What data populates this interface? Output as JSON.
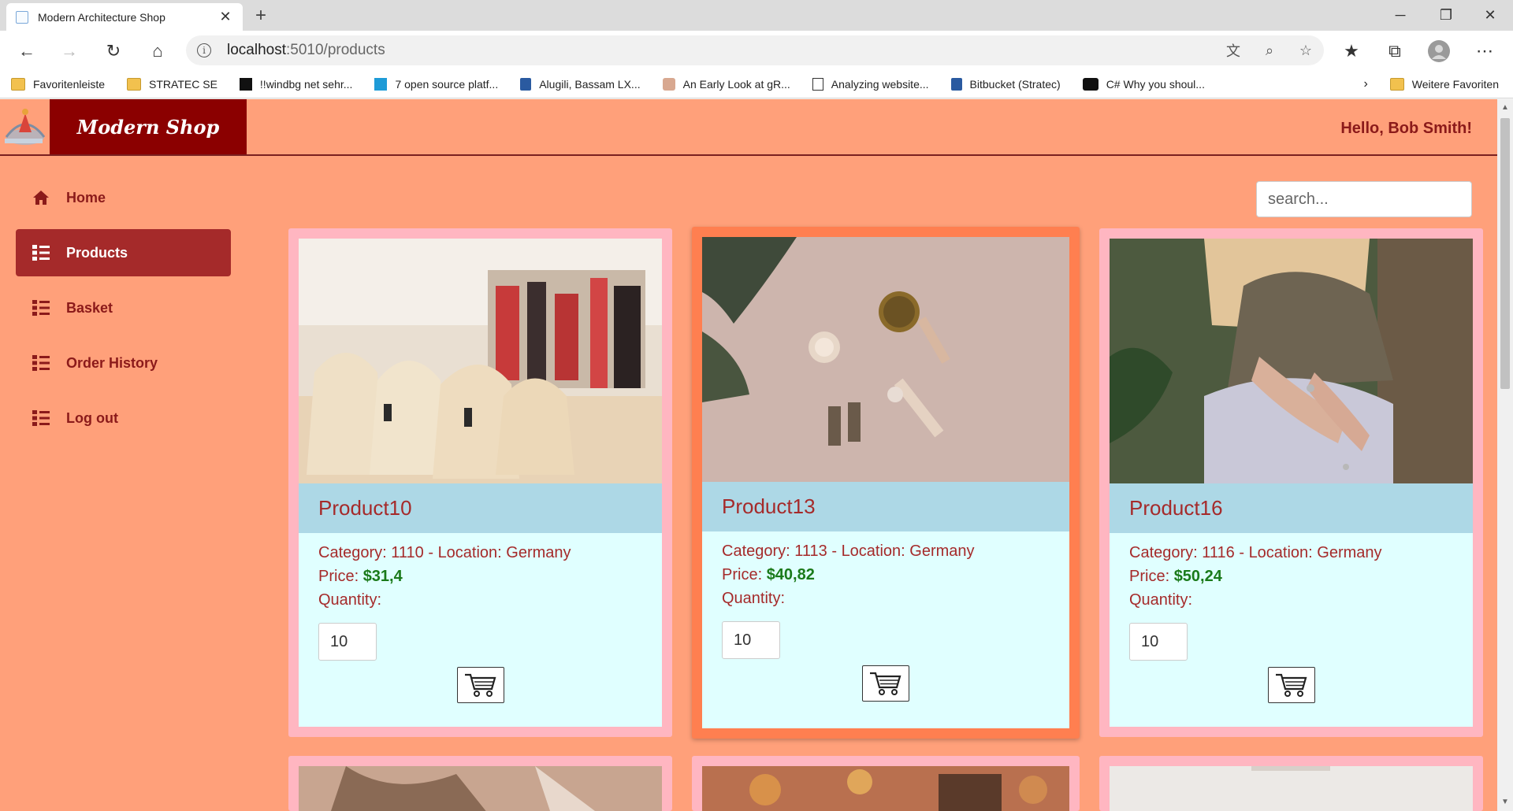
{
  "browser": {
    "tab_title": "Modern Architecture Shop",
    "url_host": "localhost",
    "url_path": ":5010/products",
    "bookmarks": [
      "Favoritenleiste",
      "STRATEC SE",
      "!!windbg  net sehr...",
      "7 open source platf...",
      "Alugili, Bassam    LX...",
      "An Early Look at gR...",
      "Analyzing website...",
      "Bitbucket (Stratec)",
      "C#  Why you shoul..."
    ],
    "bookmarks_other": "Weitere Favoriten"
  },
  "site": {
    "brand": "Modern Shop",
    "greeting": "Hello, Bob Smith!",
    "search_placeholder": "search...",
    "nav": [
      {
        "label": "Home",
        "icon": "home-icon"
      },
      {
        "label": "Products",
        "icon": "list-icon",
        "active": true
      },
      {
        "label": "Basket",
        "icon": "list-icon"
      },
      {
        "label": "Order History",
        "icon": "list-icon"
      },
      {
        "label": "Log out",
        "icon": "list-icon"
      }
    ]
  },
  "colors": {
    "page_bg": "#ffa07a",
    "brand_bg": "#8b0000",
    "card_bg": "#ffb6c1",
    "card_hover_bg": "#ff7f50",
    "card_inner": "#e0ffff",
    "title_bar": "#add8e6",
    "text": "#a52a2a",
    "price": "#1a7a1a"
  },
  "products": [
    {
      "name": "Product10",
      "category": "Category: 1110 - Location: Germany",
      "price_label": "Price: ",
      "price": "$31,4",
      "quantity_label": "Quantity:",
      "quantity": "10",
      "image": "handbags-store"
    },
    {
      "name": "Product13",
      "category": "Category: 1113 - Location: Germany",
      "price_label": "Price: ",
      "price": "$40,82",
      "quantity_label": "Quantity:",
      "quantity": "10",
      "image": "cosmetics-flatlay"
    },
    {
      "name": "Product16",
      "category": "Category: 1116 - Location: Germany",
      "price_label": "Price: ",
      "price": "$50,24",
      "quantity_label": "Quantity:",
      "quantity": "10",
      "image": "woman-rings"
    }
  ]
}
